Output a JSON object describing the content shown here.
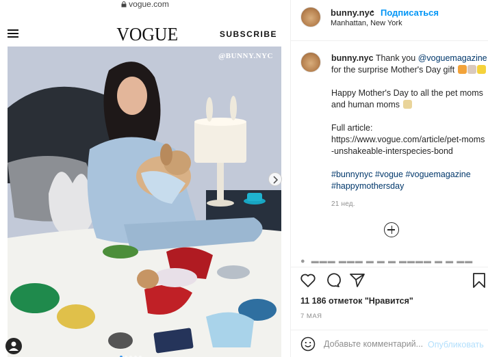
{
  "browser": {
    "url": "vogue.com"
  },
  "vogue": {
    "logo": "VOGUE",
    "subscribe": "SUBSCRIBE"
  },
  "photo": {
    "watermark": "@BUNNY.NYC",
    "carousel_dots": 5,
    "active_dot": 1
  },
  "post": {
    "username": "bunny.nyc",
    "separator": "•",
    "follow_label": "Подписаться",
    "location": "Manhattan, New York",
    "caption": {
      "username": "bunny.nyc",
      "intro": " Thank you ",
      "mention": "@voguemagazine",
      "line1_tail": " for the surprise Mother's Day gift ",
      "para2": "Happy Mother's Day to all the pet moms and human moms ",
      "para3_label": "Full article:",
      "para3_url": "https://www.vogue.com/article/pet-moms-unshakeable-interspecies-bond",
      "tags": [
        "#bunnynyc",
        "#vogue",
        "#voguemagazine",
        "#happymothersday"
      ]
    },
    "age": "21 нед.",
    "likes": "11 186 отметок \"Нравится\"",
    "date": "7 МАЯ",
    "comment_placeholder": "Добавьте комментарий...",
    "publish_label": "Опубликовать"
  },
  "colors": {
    "link": "#00376b",
    "follow": "#0095f6",
    "publish_disabled": "#b2dffc"
  },
  "icons": [
    "lock-icon",
    "hamburger-icon",
    "chevron-right-icon",
    "heart-icon",
    "comment-icon",
    "share-icon",
    "bookmark-icon",
    "smile-icon",
    "plus-circle-icon"
  ]
}
